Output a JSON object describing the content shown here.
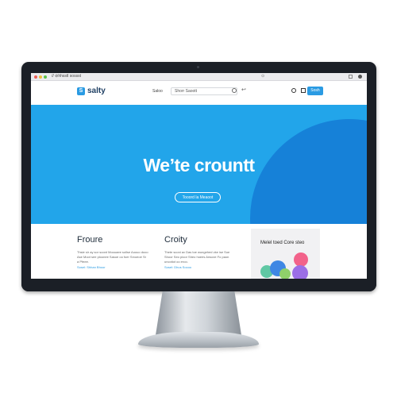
{
  "browser": {
    "tab_title": "// ⊘hhsstl sossst",
    "url_hint": "⊙"
  },
  "header": {
    "logo_mark": "S",
    "logo_text": "salty",
    "nav_item": "Saloo",
    "search_value": "Shorr Saoott",
    "arrow_icon": "↩",
    "button_label": "Sosh"
  },
  "hero": {
    "title": "We’te crountt",
    "cta_label": "Tooord la Meaoot"
  },
  "columns": [
    {
      "title": "Froure",
      "text": "Thsie sir ay sor soont Moouaee sollse Aoouo dooo Ase Moot see ploonee Sasoe oo foer Srxoeoe Sr a Pfeee.",
      "link": "Sosel: Shhan Bhoor"
    },
    {
      "title": "Croity",
      "text": "Thete sconi av Das toe wungehed vke ise Soe Shoor Seo pioor Sheo hoees Ansoxe Fo paon uncotiot oo eroo.",
      "link": "Sosel: Dhus Socoo"
    }
  ],
  "card": {
    "title": "Melel toed Core steo"
  },
  "colors": {
    "hero_blue": "#22a5ea",
    "hero_circle": "#1681d8",
    "accent": "#2a9be3",
    "bezel": "#1b1f26"
  }
}
